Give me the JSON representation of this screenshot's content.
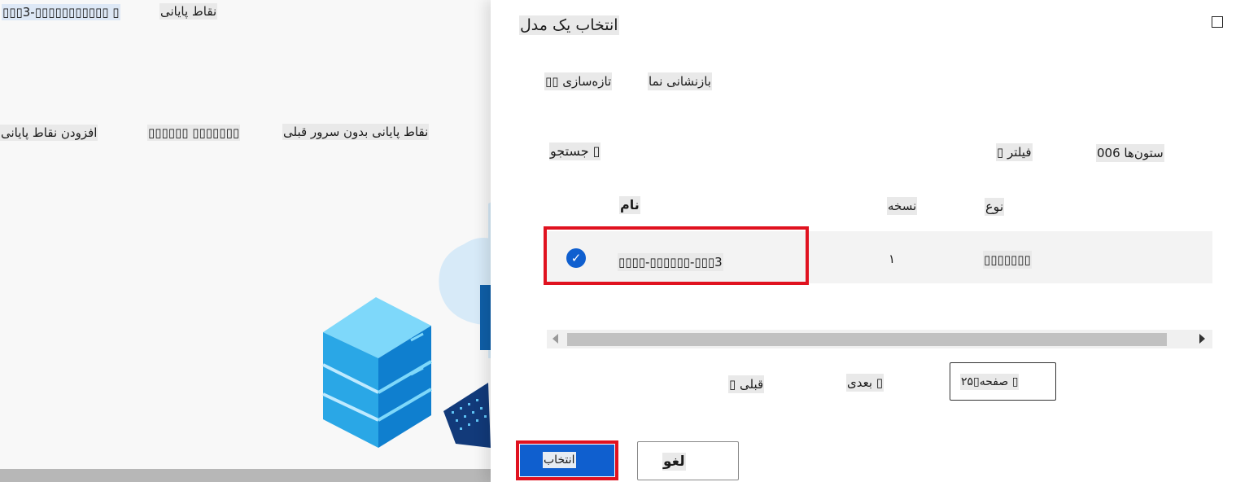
{
  "left_panel": {
    "breadcrumb_project": "▯▯▯3-▯▯▯▯▯▯▯▯▯▯▯ ▯",
    "breadcrumb_page": "نقاط پایانی",
    "tab_add_endpoint": "افزودن نقاط پایانی",
    "tab_middle": "▯▯▯▯▯▯ ▯▯▯▯▯▯▯",
    "tab_serverless": "نقاط پایانی بدون سرور قبلی"
  },
  "dialog": {
    "title": "انتخاب یک مدل",
    "toolbar": {
      "refresh": "▯▯ تازه‌سازی",
      "reset_view": "بازنشانی نما"
    },
    "search_placeholder": "جستجو ▯",
    "filter_label": "▯ فیلتر",
    "columns_label": "006 ستون‌ها",
    "table": {
      "headers": {
        "name": "نام",
        "version": "نسخه",
        "type": "نوع"
      },
      "rows": [
        {
          "name": "▯▯▯▯-▯▯▯▯▯▯-▯▯▯3",
          "version": "۱",
          "type": "▯▯▯▯▯▯▯",
          "selected": true
        }
      ]
    },
    "pagination": {
      "prev": "▯ قبلی",
      "next": "بعدی ▯",
      "page_size": "۲۵▯صفحه ▯"
    },
    "buttons": {
      "select": "انتخاب",
      "cancel": "لغو"
    }
  }
}
